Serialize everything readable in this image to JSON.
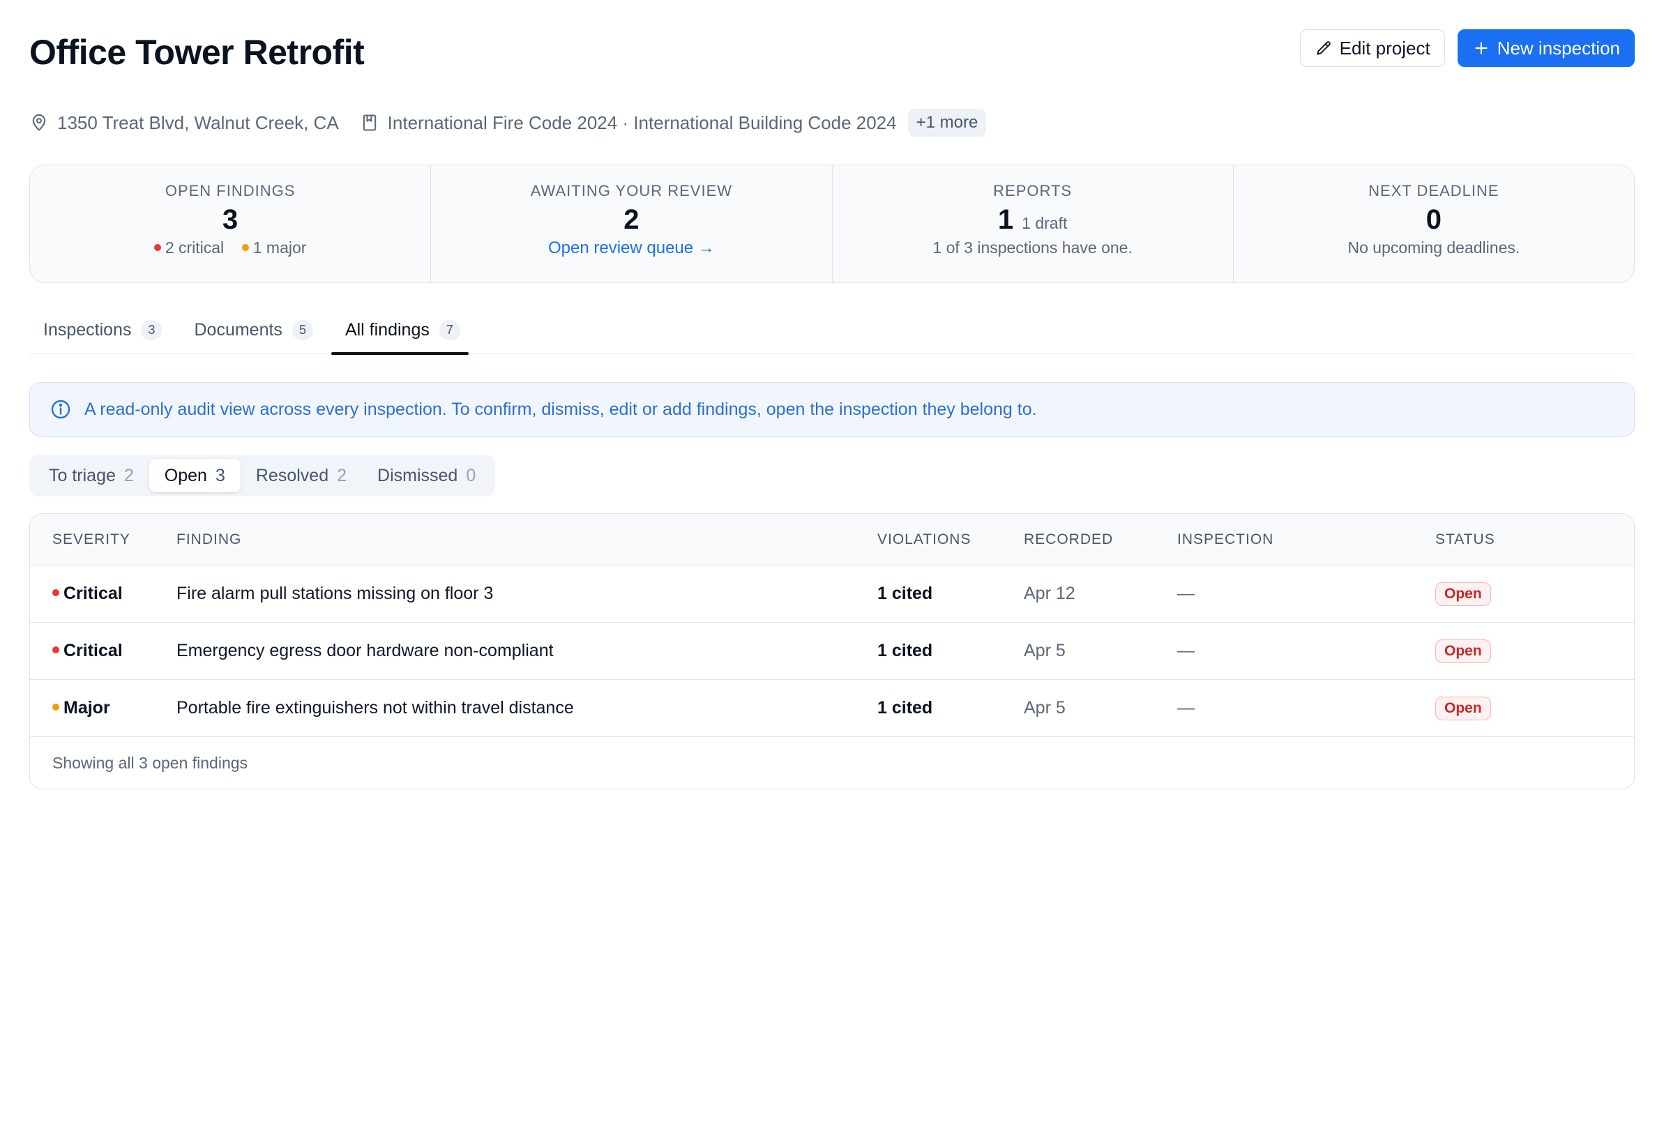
{
  "project": {
    "title": "Office Tower Retrofit",
    "address": "1350 Treat Blvd, Walnut Creek, CA",
    "codes": "International Fire Code 2024 · International Building Code 2024",
    "codes_more": "+1 more"
  },
  "actions": {
    "edit_label": "Edit project",
    "new_label": "New inspection"
  },
  "stats": {
    "open_findings": {
      "label": "OPEN FINDINGS",
      "value": "3",
      "critical": "2 critical",
      "major": "1 major"
    },
    "awaiting": {
      "label": "AWAITING YOUR REVIEW",
      "value": "2",
      "link": "Open review queue →"
    },
    "reports": {
      "label": "REPORTS",
      "value": "1",
      "sub": "1 draft",
      "desc": "1 of 3 inspections have one."
    },
    "deadline": {
      "label": "NEXT DEADLINE",
      "value": "0",
      "desc": "No upcoming deadlines."
    }
  },
  "tabs": [
    {
      "label": "Inspections",
      "count": "3"
    },
    {
      "label": "Documents",
      "count": "5"
    },
    {
      "label": "All findings",
      "count": "7"
    }
  ],
  "info_banner": "A read-only audit view across every inspection. To confirm, dismiss, edit or add findings, open the inspection they belong to.",
  "filters": [
    {
      "label": "To triage",
      "count": "2"
    },
    {
      "label": "Open",
      "count": "3"
    },
    {
      "label": "Resolved",
      "count": "2"
    },
    {
      "label": "Dismissed",
      "count": "0"
    }
  ],
  "table": {
    "headers": [
      "SEVERITY",
      "FINDING",
      "VIOLATIONS",
      "RECORDED",
      "INSPECTION",
      "STATUS"
    ],
    "rows": [
      {
        "severity": "Critical",
        "finding": "Fire alarm pull stations missing on floor 3",
        "violations": "1 cited",
        "recorded": "Apr 12",
        "inspection": "—",
        "status": "Open"
      },
      {
        "severity": "Critical",
        "finding": "Emergency egress door hardware non-compliant",
        "violations": "1 cited",
        "recorded": "Apr 5",
        "inspection": "—",
        "status": "Open"
      },
      {
        "severity": "Major",
        "finding": "Portable fire extinguishers not within travel distance",
        "violations": "1 cited",
        "recorded": "Apr 5",
        "inspection": "—",
        "status": "Open"
      }
    ],
    "footer": "Showing all 3 open findings"
  },
  "colors": {
    "accent": "#1b6ff2",
    "critical": "#e53935",
    "major": "#f59e0b",
    "open_badge": "#c62828"
  }
}
